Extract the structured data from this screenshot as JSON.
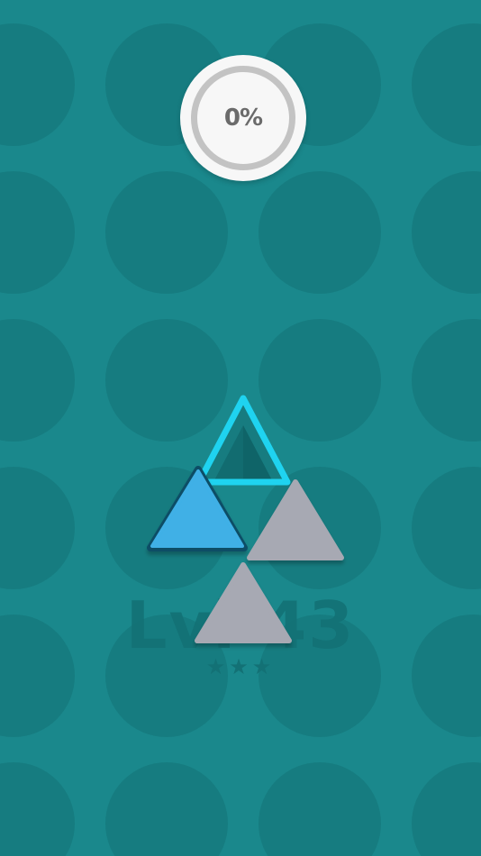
{
  "progress": {
    "label": "0%",
    "fraction": 0.0
  },
  "level": {
    "label": "Lvl 43",
    "stars_text": "★★★",
    "stars_earned": 0,
    "stars_total": 3
  },
  "pieces": [
    {
      "id": "target-slot",
      "color": "#1fd3f0",
      "state": "outline"
    },
    {
      "id": "selected-piece",
      "color": "#3fb0e6",
      "state": "selected"
    },
    {
      "id": "piece-right",
      "color": "#a7a9b3",
      "state": "idle"
    },
    {
      "id": "piece-bottom",
      "color": "#a7a9b3",
      "state": "idle"
    }
  ],
  "colors": {
    "background": "#1a888c",
    "pattern": "#167a7e",
    "text_faded": "#137175"
  }
}
